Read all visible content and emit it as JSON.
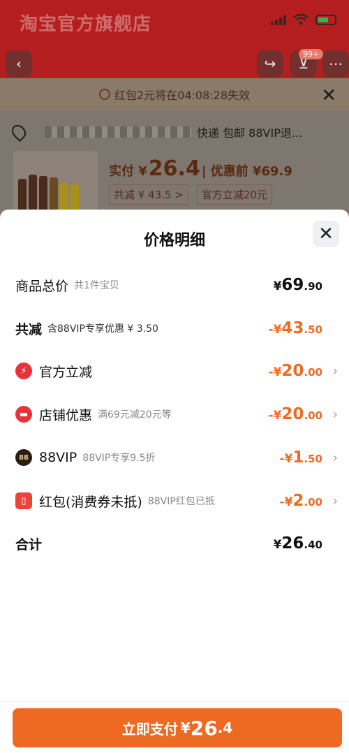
{
  "background": {
    "store_name": "淘宝官方旗舰店",
    "cart_badge": "99+",
    "banner_text": "红包2元将在04:08:28失效",
    "address_suffix": "快递 包邮 88VIP退...",
    "price_label": "实付 ¥",
    "price_value": "26.4",
    "price_before": "| 优惠前 ¥69.9",
    "chip_saved": "共减 ¥ 43.5 >",
    "chip_official": "官方立减20元"
  },
  "modal": {
    "title": "价格明细",
    "rows": [
      {
        "label": "商品总价",
        "sub": "共1件宝贝",
        "currency": "¥",
        "int": "69",
        "dec": ".90"
      },
      {
        "label": "共减",
        "sub": "含88VIP专享优惠 ¥ 3.50",
        "currency": "-¥",
        "int": "43",
        "dec": ".50"
      },
      {
        "label": "官方立减",
        "sub": "",
        "currency": "-¥",
        "int": "20",
        "dec": ".00",
        "icon": "lightning-icon"
      },
      {
        "label": "店铺优惠",
        "sub": "满69元减20元等",
        "currency": "-¥",
        "int": "20",
        "dec": ".00",
        "icon": "shop-icon"
      },
      {
        "label": "88VIP",
        "sub": "88VIP专享9.5折",
        "currency": "-¥",
        "int": "1",
        "dec": ".50",
        "icon": "vip-icon",
        "icon_text": "88"
      },
      {
        "label": "红包(消费券未抵)",
        "sub": "88VIP红包已抵",
        "currency": "-¥",
        "int": "2",
        "dec": ".00",
        "icon": "red-packet-icon"
      },
      {
        "label": "合计",
        "sub": "",
        "currency": "¥",
        "int": "26",
        "dec": ".40"
      }
    ]
  },
  "pay": {
    "label": "立即支付",
    "currency": "¥",
    "int": "26",
    "dec": ".4"
  },
  "colors": {
    "accent": "#ee6a22",
    "discount": "#ef6a22",
    "header_red": "#b51e1e"
  }
}
